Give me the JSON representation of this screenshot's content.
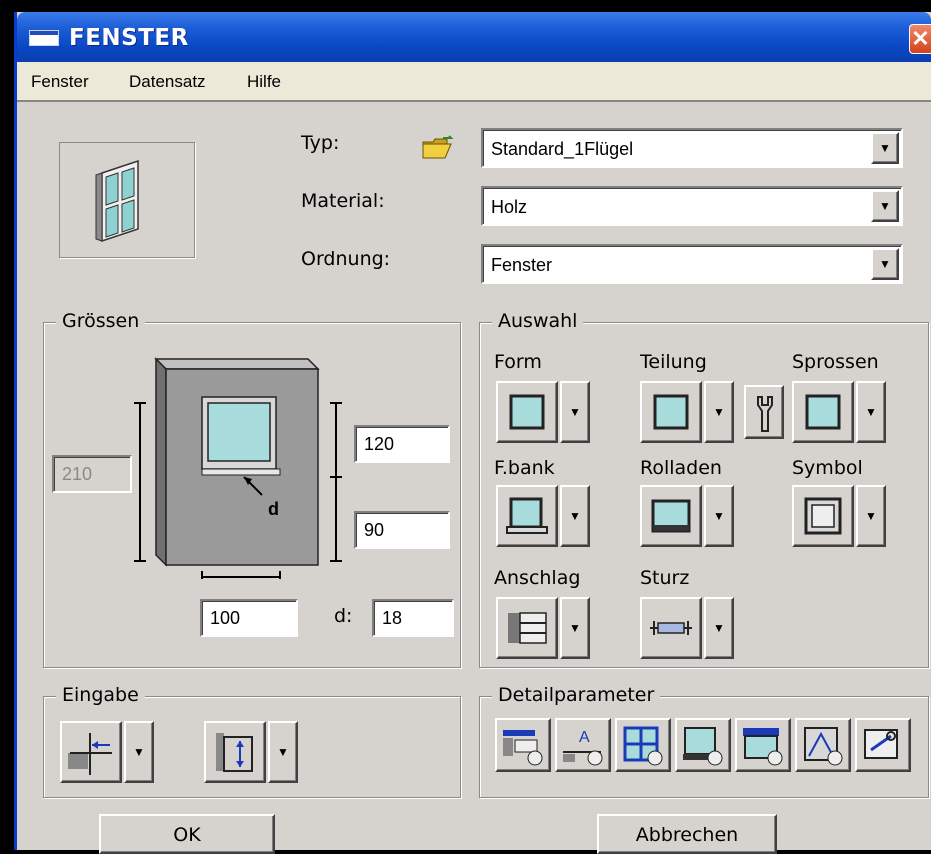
{
  "window": {
    "title": "FENSTER",
    "close_label": "✕"
  },
  "menu": {
    "items": [
      "Fenster",
      "Datensatz",
      "Hilfe"
    ]
  },
  "header": {
    "typ_label": "Typ:",
    "typ_value": "Standard_1Flügel",
    "material_label": "Material:",
    "material_value": "Holz",
    "ordnung_label": "Ordnung:",
    "ordnung_value": "Fenster"
  },
  "groessen": {
    "title": "Grössen",
    "total_height": "210",
    "height_top": "120",
    "height_bottom": "90",
    "width": "100",
    "depth_label": "d:",
    "depth_value": "18",
    "depth_marker": "d"
  },
  "auswahl": {
    "title": "Auswahl",
    "form": "Form",
    "teilung": "Teilung",
    "sprossen": "Sprossen",
    "fbank": "F.bank",
    "rolladen": "Rolladen",
    "symbol": "Symbol",
    "anschlag": "Anschlag",
    "sturz": "Sturz"
  },
  "eingabe": {
    "title": "Eingabe"
  },
  "detail": {
    "title": "Detailparameter"
  },
  "buttons": {
    "ok": "OK",
    "cancel": "Abbrechen"
  },
  "colors": {
    "titlebar": "#0a47c4",
    "glass": "#a8dcdc",
    "panel": "#d6d3ce"
  }
}
